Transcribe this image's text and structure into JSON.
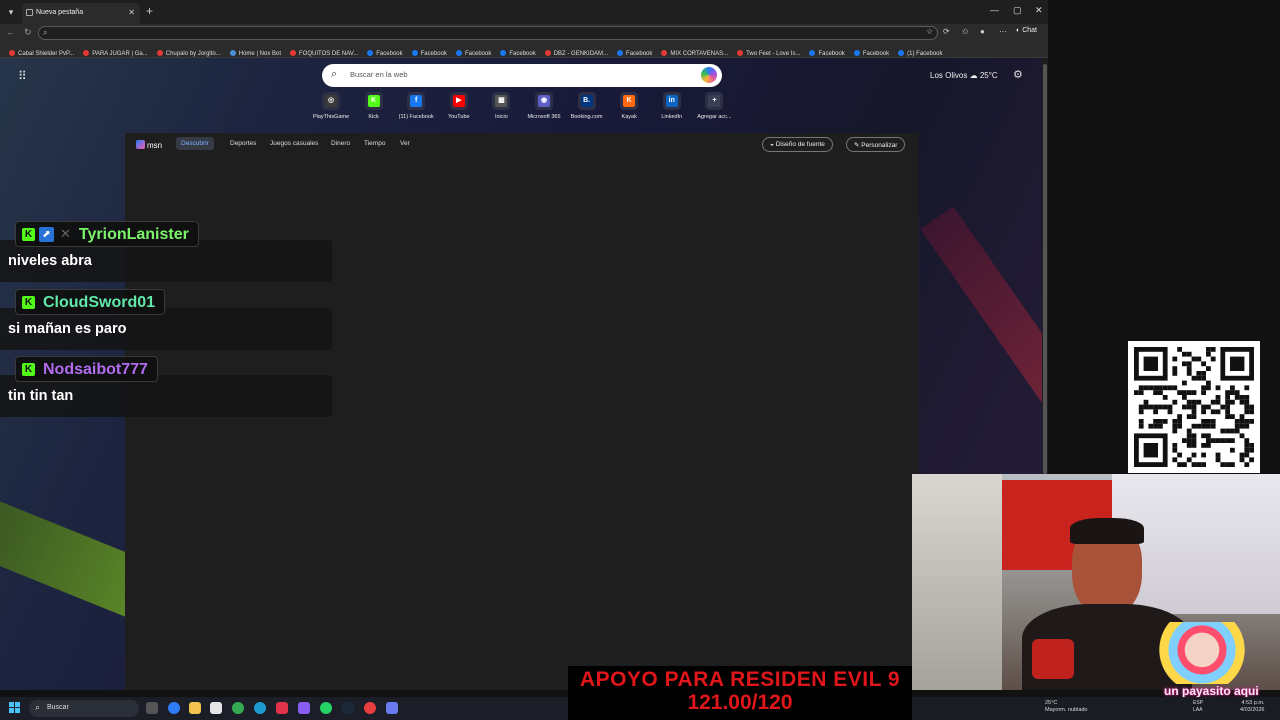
{
  "browser": {
    "tab_title": "Nueva pestaña",
    "new_tab_label": "+",
    "chat_label": "Chat",
    "bookmarks": [
      {
        "label": "Cabal Shielder PvP...",
        "color": "#e53935"
      },
      {
        "label": "PARA JUGAR | Ga...",
        "color": "#e53935"
      },
      {
        "label": "Chupalo by Jorgito...",
        "color": "#e53935"
      },
      {
        "label": "Home | Nox Bot",
        "color": "#4a90d9"
      },
      {
        "label": "FOQUITOS DE NAV...",
        "color": "#e53935"
      },
      {
        "label": "Facebook",
        "color": "#1877f2"
      },
      {
        "label": "Facebook",
        "color": "#1877f2"
      },
      {
        "label": "Facebook",
        "color": "#1877f2"
      },
      {
        "label": "Facebook",
        "color": "#1877f2"
      },
      {
        "label": "DBZ - GENKIDAM...",
        "color": "#e53935"
      },
      {
        "label": "Facebook",
        "color": "#1877f2"
      },
      {
        "label": "MIX CORTAVENAS...",
        "color": "#e53935"
      },
      {
        "label": "Two Feet - Love Is...",
        "color": "#e53935"
      },
      {
        "label": "Facebook",
        "color": "#1877f2"
      },
      {
        "label": "Facebook",
        "color": "#1877f2"
      },
      {
        "label": "(1) Facebook",
        "color": "#1877f2"
      }
    ]
  },
  "ntp": {
    "search_placeholder": "Buscar en la web",
    "weather": {
      "location": "Los Olivos",
      "temp": "25°C"
    },
    "quick_links": [
      {
        "label": "PlayThisGame",
        "color": "#3a3a3a",
        "glyph": "◎"
      },
      {
        "label": "Kick",
        "color": "#53fc18",
        "glyph": "K"
      },
      {
        "label": "(11) Facebook",
        "color": "#1877f2",
        "glyph": "f"
      },
      {
        "label": "YouTube",
        "color": "#ff0000",
        "glyph": "▶"
      },
      {
        "label": "Inicio",
        "color": "#555555",
        "glyph": "▦"
      },
      {
        "label": "Microsoft 365",
        "color": "#5b5fc7",
        "glyph": "◉"
      },
      {
        "label": "Booking.com",
        "color": "#003580",
        "glyph": "B."
      },
      {
        "label": "Kayak",
        "color": "#ff690f",
        "glyph": "K"
      },
      {
        "label": "LinkedIn",
        "color": "#0a66c2",
        "glyph": "in"
      },
      {
        "label": "Agregar acc...",
        "color": "#3b3f55",
        "glyph": "+"
      }
    ],
    "feed": {
      "brand": "msn",
      "tabs": [
        "Descubrir",
        "Deportes",
        "Juegos casuales",
        "Dinero",
        "Tiempo",
        "Ver"
      ],
      "active_tab": "Descubrir",
      "font_button": "Diseño de fuente",
      "personalize_button": "Personalizar"
    }
  },
  "chat": [
    {
      "user": "TyrionLanister",
      "color": "#7cf56b",
      "message": "niveles abra"
    },
    {
      "user": "CloudSword01",
      "color": "#5fe8a8",
      "message": "si mañan es paro"
    },
    {
      "user": "Nodsaibot777",
      "color": "#b26cf0",
      "message": "tin tin tan"
    }
  ],
  "overlay": {
    "donation_title": "APOYO PARA RESIDEN EVIL 9",
    "donation_amount": "121.00/120",
    "clown_caption": "un payasito aqui"
  },
  "taskbar": {
    "search_label": "Buscar",
    "weather_temp": "25°C",
    "weather_desc": "Mayorm. nublado",
    "lang": "ESP",
    "lang2": "LAA",
    "time": "4:53 p.m.",
    "date": "4/03/2026"
  }
}
